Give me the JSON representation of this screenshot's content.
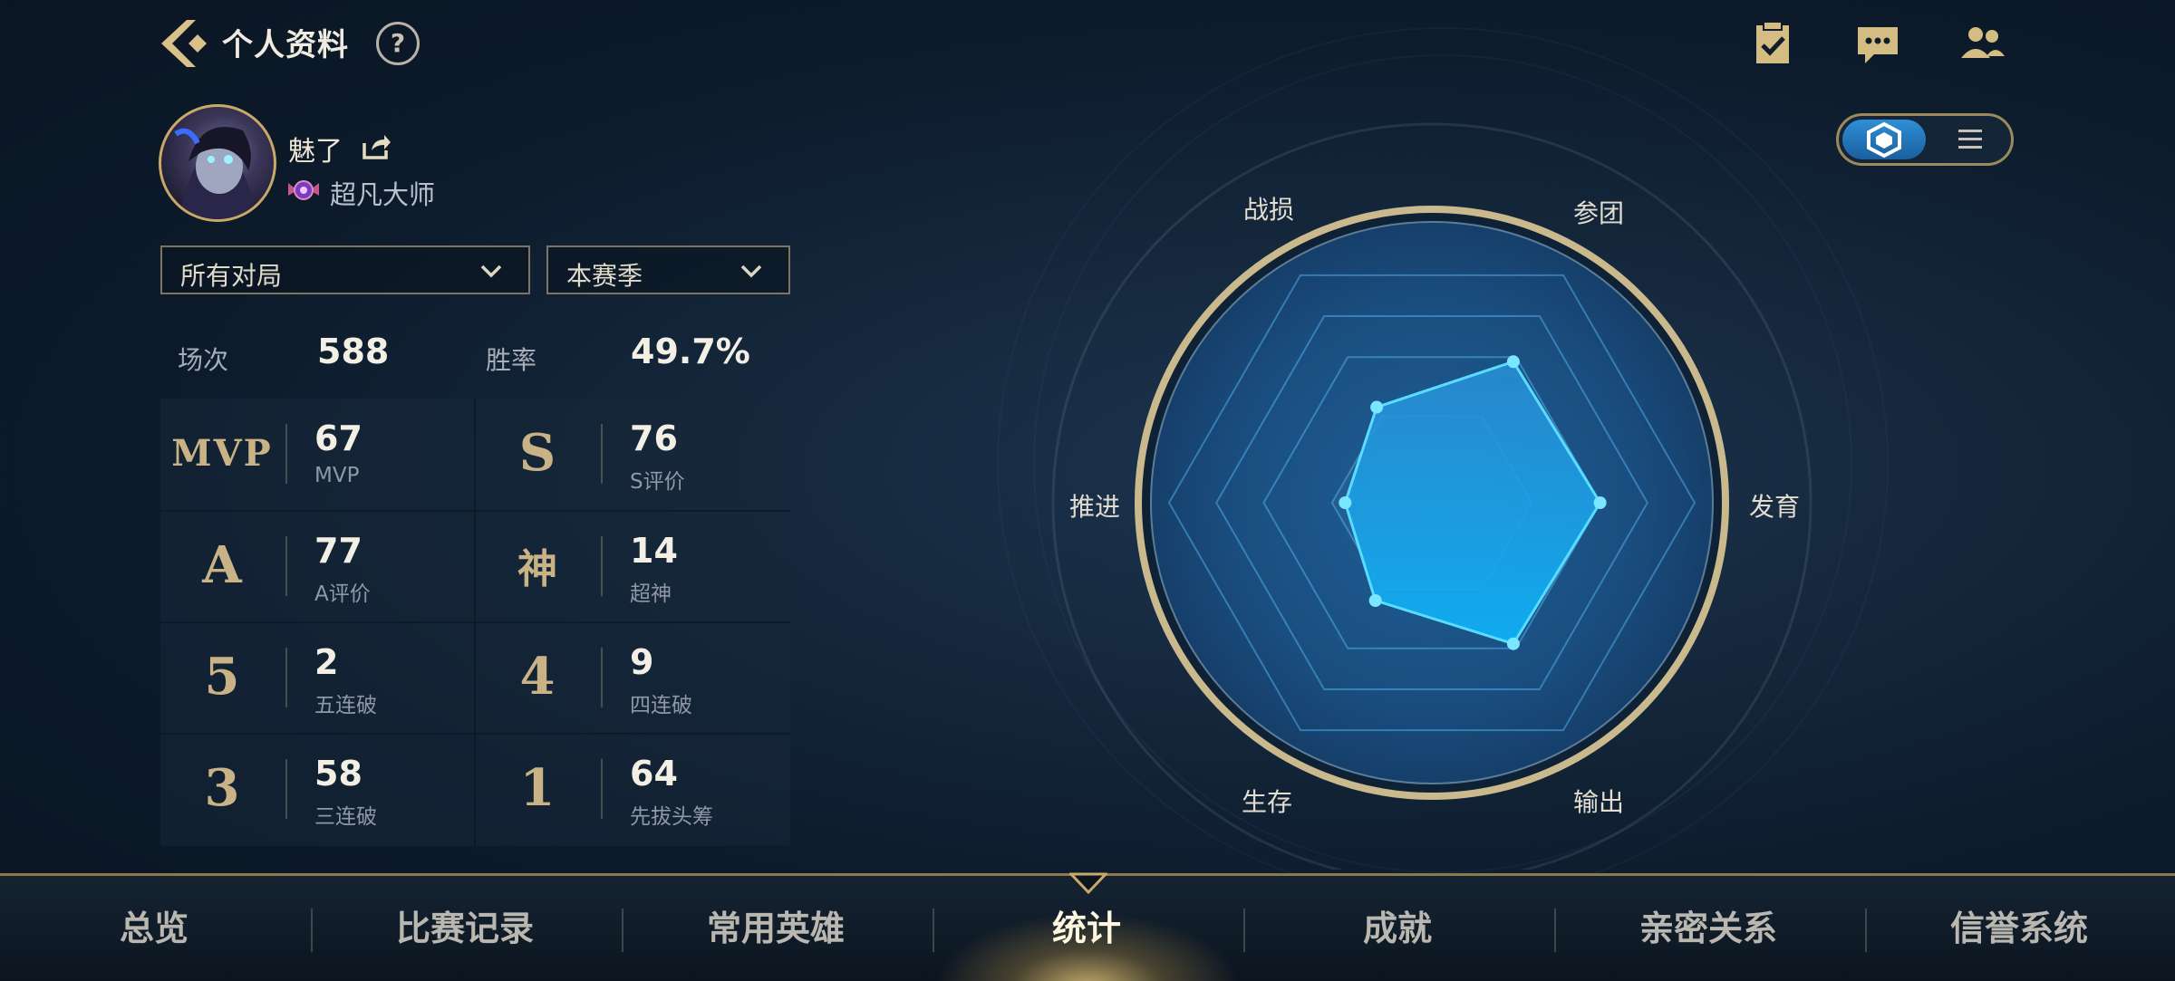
{
  "header": {
    "title": "个人资料",
    "help": "?"
  },
  "top_icons": [
    "task-check-icon",
    "chat-icon",
    "friends-icon"
  ],
  "profile": {
    "username": "魅了",
    "rank": "超凡大师"
  },
  "filters": {
    "mode": "所有对局",
    "season": "本赛季"
  },
  "summary": [
    {
      "label": "场次",
      "value": "588"
    },
    {
      "label": "胜率",
      "value": "49.7%"
    }
  ],
  "stats": [
    {
      "badge": "MVP",
      "value": "67",
      "label": "MVP"
    },
    {
      "badge": "S",
      "value": "76",
      "label": "S评价"
    },
    {
      "badge": "A",
      "value": "77",
      "label": "A评价"
    },
    {
      "badge": "神",
      "value": "14",
      "label": "超神"
    },
    {
      "badge": "5",
      "value": "2",
      "label": "五连破"
    },
    {
      "badge": "4",
      "value": "9",
      "label": "四连破"
    },
    {
      "badge": "3",
      "value": "58",
      "label": "三连破"
    },
    {
      "badge": "1",
      "value": "64",
      "label": "先拔头筹"
    }
  ],
  "radar": {
    "axes": [
      "战损",
      "参团",
      "发育",
      "输出",
      "生存",
      "推进"
    ],
    "values": [
      0.42,
      0.62,
      0.64,
      0.62,
      0.43,
      0.33
    ]
  },
  "view_toggle": {
    "active": "radar"
  },
  "tabs": [
    "总览",
    "比赛记录",
    "常用英雄",
    "统计",
    "成就",
    "亲密关系",
    "信誉系统"
  ],
  "active_tab": 3,
  "colors": {
    "accent_gold": "#c9a967",
    "radar_blue": "#1e9be8",
    "active_tab_glow": "#ffd782"
  }
}
